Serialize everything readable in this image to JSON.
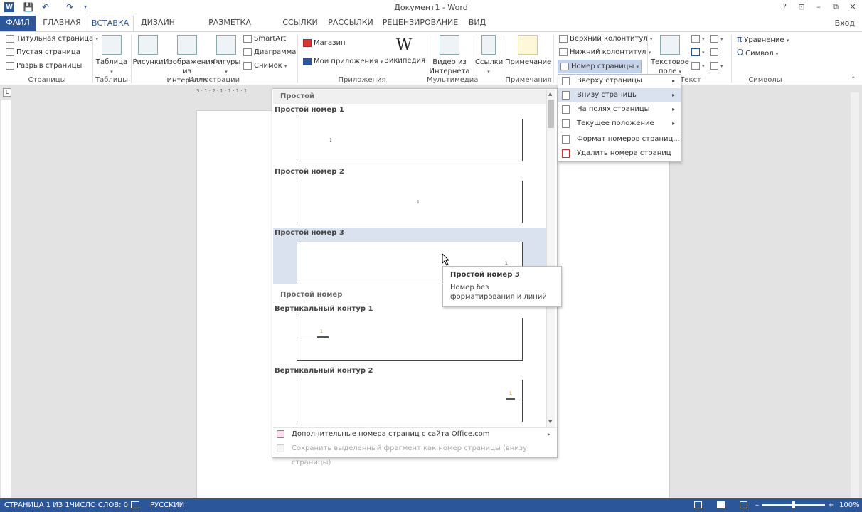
{
  "titlebar": {
    "title": "Документ1 - Word",
    "signin": "Вход",
    "help": "?",
    "minimize": "–",
    "restore": "⧉",
    "close": "✕",
    "ribbon_opts": "⊡"
  },
  "tabs": [
    {
      "label": "ФАЙЛ"
    },
    {
      "label": "ГЛАВНАЯ"
    },
    {
      "label": "ВСТАВКА",
      "active": true
    },
    {
      "label": "ДИЗАЙН"
    },
    {
      "label": "РАЗМЕТКА СТРАНИЦЫ"
    },
    {
      "label": "ССЫЛКИ"
    },
    {
      "label": "РАССЫЛКИ"
    },
    {
      "label": "РЕЦЕНЗИРОВАНИЕ"
    },
    {
      "label": "ВИД"
    }
  ],
  "ribbon": {
    "pages": {
      "title_page": "Титульная страница",
      "blank_page": "Пустая страница",
      "page_break": "Разрыв страницы",
      "label": "Страницы"
    },
    "tables": {
      "table": "Таблица",
      "label": "Таблицы"
    },
    "illustrations": {
      "pictures": "Рисунки",
      "online_pictures_1": "Изображения",
      "online_pictures_2": "из Интернета",
      "shapes": "Фигуры",
      "smartart": "SmartArt",
      "chart": "Диаграмма",
      "screenshot": "Снимок",
      "label": "Иллюстрации"
    },
    "apps": {
      "store": "Магазин",
      "my_apps": "Мои приложения",
      "wikipedia": "Википедия",
      "label": "Приложения"
    },
    "media": {
      "video_1": "Видео из",
      "video_2": "Интернета",
      "label": "Мультимедиа"
    },
    "links": {
      "links": "Ссылки"
    },
    "comments": {
      "comment": "Примечание",
      "label": "Примечания"
    },
    "header_footer": {
      "header": "Верхний колонтитул",
      "footer": "Нижний колонтитул",
      "page_number": "Номер страницы"
    },
    "text": {
      "textbox_1": "Текстовое",
      "textbox_2": "поле",
      "label": "Текст"
    },
    "symbols": {
      "equation": "Уравнение",
      "symbol": "Символ",
      "label": "Символы"
    }
  },
  "ruler": {
    "h_marks": "3 · 1 · 2 · 1 · 1 · 1 · 1"
  },
  "gallery": {
    "section_header": "Простой",
    "items": [
      {
        "title": "Простой номер 1",
        "num": "1"
      },
      {
        "title": "Простой номер 2",
        "num": "1"
      },
      {
        "title": "Простой номер 3",
        "num": "1"
      },
      {
        "title": "Вертикальный контур 1",
        "num": "1"
      },
      {
        "title": "Вертикальный контур 2",
        "num": "1"
      }
    ],
    "section_header2": "Простой номер",
    "more_from_office": "Дополнительные номера страниц с сайта Office.com",
    "save_selection": "Сохранить выделенный фрагмент как номер страницы (внизу страницы)"
  },
  "submenu": [
    {
      "label": "Вверху страницы",
      "arrow": "▸"
    },
    {
      "label": "Внизу страницы",
      "arrow": "▸"
    },
    {
      "label": "На полях страницы",
      "arrow": "▸"
    },
    {
      "label": "Текущее положение",
      "arrow": "▸"
    },
    {
      "label": "Формат номеров страниц..."
    },
    {
      "label": "Удалить номера страниц"
    }
  ],
  "tooltip": {
    "title": "Простой номер 3",
    "desc": "Номер без форматирования и линий"
  },
  "status": {
    "page": "СТРАНИЦА 1 ИЗ 1",
    "words": "ЧИСЛО СЛОВ: 0",
    "lang": "РУССКИЙ",
    "zoom": "100%",
    "zoom_minus": "–",
    "zoom_plus": "+",
    "zoom_level": 0.5
  },
  "colors": {
    "accent": "#2b579a",
    "highlight": "#dae2ef"
  }
}
